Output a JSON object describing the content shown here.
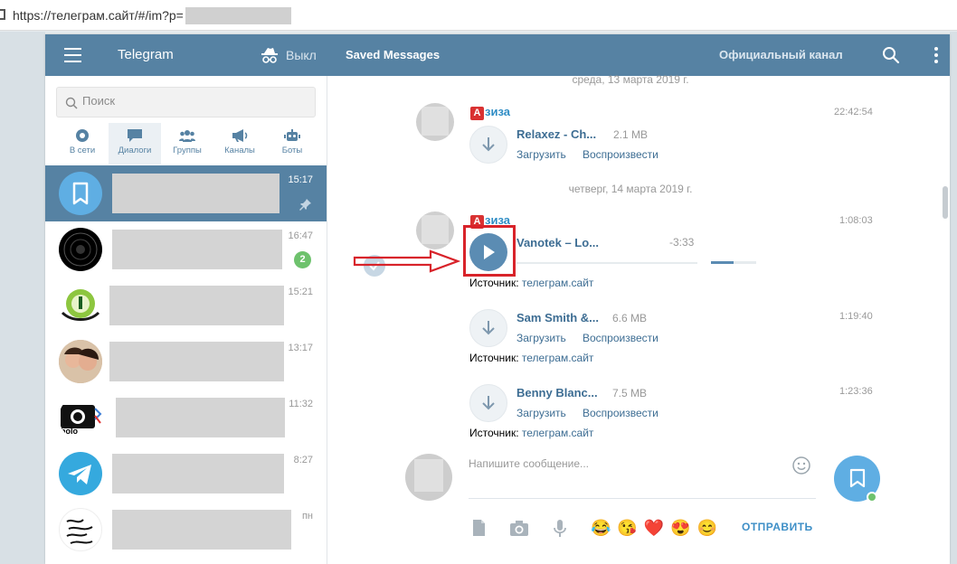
{
  "browser": {
    "url": "https://телеграм.сайт/#/im?p="
  },
  "header": {
    "app_title": "Telegram",
    "incognito_label": "Выкл",
    "peer_title": "Saved Messages",
    "channel_label": "Официальный канал"
  },
  "sidebar": {
    "search_placeholder": "Поиск",
    "filters": [
      {
        "label": "В сети",
        "icon": "online-dot-icon"
      },
      {
        "label": "Диалоги",
        "icon": "chat-bubble-icon"
      },
      {
        "label": "Группы",
        "icon": "group-icon"
      },
      {
        "label": "Каналы",
        "icon": "megaphone-icon"
      },
      {
        "label": "Боты",
        "icon": "bot-icon"
      }
    ],
    "chats": [
      {
        "time": "15:17",
        "pinned": true
      },
      {
        "time": "16:47",
        "unread": "2"
      },
      {
        "time": "15:21"
      },
      {
        "time": "13:17"
      },
      {
        "time": "11:32",
        "avatar_text": "holo"
      },
      {
        "time": "8:27"
      },
      {
        "time": "пн"
      }
    ]
  },
  "messages": {
    "date_1": "среда, 13 марта 2019 г.",
    "date_2": "четверг, 14 марта 2019 г.",
    "author_badge": "А",
    "author_rest": "зиза",
    "items": [
      {
        "time": "22:42:54",
        "file_name": "Relaxez - Ch...",
        "size": "2.1 MB",
        "download": "Загрузить",
        "play": "Воспроизвести"
      },
      {
        "time": "1:08:03",
        "file_name": "Vanotek – Lo...",
        "duration": "-3:33",
        "source_label": "Источник:",
        "source_link": "телеграм.сайт",
        "volume": 0.5
      },
      {
        "time": "1:19:40",
        "file_name": "Sam Smith &...",
        "size": "6.6 MB",
        "download": "Загрузить",
        "play": "Воспроизвести",
        "source_label": "Источник:",
        "source_link": "телеграм.сайт"
      },
      {
        "time": "1:23:36",
        "file_name": "Benny Blanc...",
        "size": "7.5 MB",
        "download": "Загрузить",
        "play": "Воспроизвести",
        "source_label": "Источник:",
        "source_link": "телеграм.сайт"
      }
    ]
  },
  "compose": {
    "placeholder": "Напишите сообщение...",
    "emojis": [
      "😂",
      "😘",
      "❤️",
      "😍",
      "😊"
    ],
    "send_label": "ОТПРАВИТЬ"
  },
  "colors": {
    "header": "#5682a3",
    "accent": "#3e8fc7",
    "highlight": "#d8232a",
    "online": "#6ec26d"
  }
}
